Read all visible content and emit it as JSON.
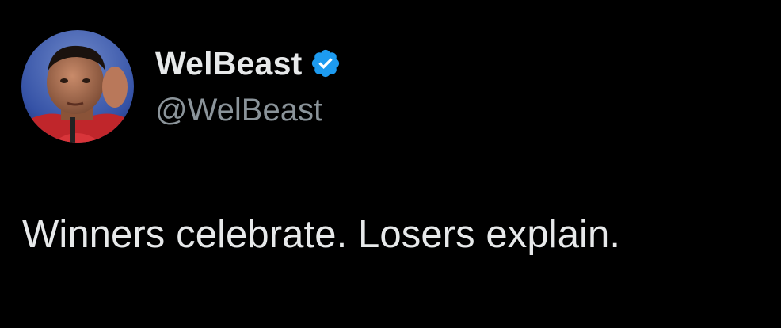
{
  "tweet": {
    "author": {
      "display_name": "WelBeast",
      "handle": "@WelBeast",
      "verified": true,
      "verified_icon": "verified-badge-icon",
      "avatar": "profile-avatar"
    },
    "text": "Winners celebrate. Losers explain."
  },
  "colors": {
    "background": "#000000",
    "primary_text": "#e7e9ea",
    "secondary_text": "#8b949a",
    "verified_blue": "#1d9bf0"
  }
}
